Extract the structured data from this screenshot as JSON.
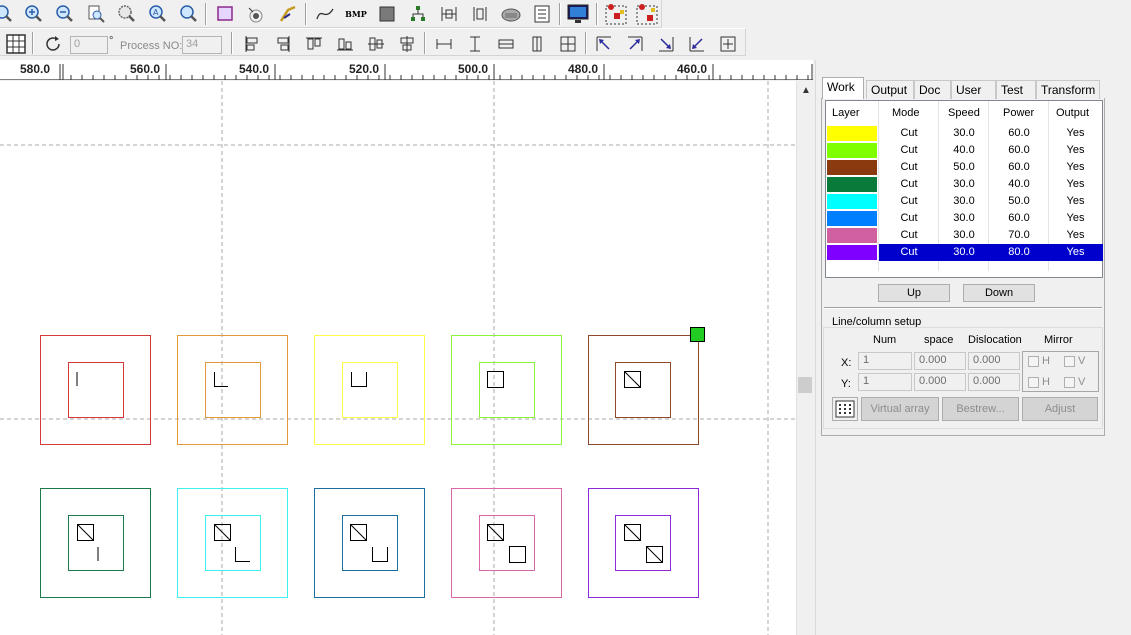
{
  "toolbar_top": {
    "icons": [
      "zoom-in-partial-icon",
      "zoom-in-icon",
      "zoom-out-icon",
      "zoom-page-icon",
      "zoom-select-icon",
      "zoom-auto-icon",
      "zoom-magnify-icon",
      "rectangle-select-icon",
      "node-edit-icon",
      "path-tool-icon",
      "curve-icon",
      "bmp-icon",
      "fill-icon",
      "tree-icon",
      "distance-icon",
      "dimension-icon",
      "cloud-icon",
      "list-icon",
      "monitor-icon",
      "laser-head-icon",
      "laser-head-2-icon"
    ],
    "bmp_text": "BMP"
  },
  "toolbar_second": {
    "rotate_value": "0",
    "degree_symbol": "°",
    "process_label": "Process NO:",
    "process_value": "34"
  },
  "ruler": {
    "labels": [
      "580.0",
      "560.0",
      "540.0",
      "520.0",
      "500.0",
      "480.0",
      "460.0"
    ]
  },
  "canvas": {
    "row1_colors": [
      "#d43a3a",
      "#e29a3c",
      "#ffff46",
      "#8df23a",
      "#8c4a2a"
    ],
    "row2_colors": [
      "#1a7a4a",
      "#3ff0f0",
      "#1c6ea0",
      "#d868a6",
      "#8a2ad8"
    ],
    "selection_handle_color": "#22cc22"
  },
  "panel": {
    "tabs": [
      "Work",
      "Output",
      "Doc",
      "User",
      "Test",
      "Transform"
    ],
    "active_tab": "Work",
    "table": {
      "headers": [
        "Layer",
        "Mode",
        "Speed",
        "Power",
        "Output"
      ],
      "rows": [
        {
          "color": "#ffff00",
          "mode": "Cut",
          "speed": "30.0",
          "power": "60.0",
          "output": "Yes"
        },
        {
          "color": "#80ff00",
          "mode": "Cut",
          "speed": "40.0",
          "power": "60.0",
          "output": "Yes"
        },
        {
          "color": "#8b3a10",
          "mode": "Cut",
          "speed": "50.0",
          "power": "60.0",
          "output": "Yes"
        },
        {
          "color": "#0a7a3a",
          "mode": "Cut",
          "speed": "30.0",
          "power": "40.0",
          "output": "Yes"
        },
        {
          "color": "#00ffff",
          "mode": "Cut",
          "speed": "30.0",
          "power": "50.0",
          "output": "Yes"
        },
        {
          "color": "#0080ff",
          "mode": "Cut",
          "speed": "30.0",
          "power": "60.0",
          "output": "Yes"
        },
        {
          "color": "#d060a0",
          "mode": "Cut",
          "speed": "30.0",
          "power": "70.0",
          "output": "Yes"
        },
        {
          "color": "#8000ff",
          "mode": "Cut",
          "speed": "30.0",
          "power": "80.0",
          "output": "Yes",
          "selected": true
        }
      ]
    },
    "up_label": "Up",
    "down_label": "Down",
    "line_column": {
      "title": "Line/column setup",
      "col_num": "Num",
      "col_space": "space",
      "col_dislocation": "Dislocation",
      "col_mirror": "Mirror",
      "x_label": "X:",
      "y_label": "Y:",
      "x_num": "1",
      "x_space": "0.000",
      "x_dislocation": "0.000",
      "y_num": "1",
      "y_space": "0.000",
      "y_dislocation": "0.000",
      "h_label": "H",
      "v_label": "V"
    },
    "virtual_array_label": "Virtual array",
    "bestrew_label": "Bestrew...",
    "adjust_label": "Adjust"
  }
}
